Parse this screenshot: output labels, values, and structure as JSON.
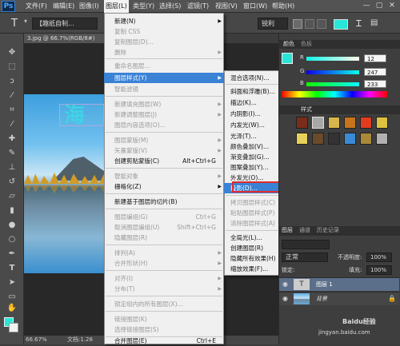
{
  "app": {
    "logo": "Ps"
  },
  "menubar": {
    "items": [
      "文件(F)",
      "编辑(E)",
      "图像(I)",
      "图层(L)",
      "类型(Y)",
      "选择(S)",
      "滤镜(T)",
      "视图(V)",
      "窗口(W)",
      "帮助(H)"
    ],
    "active_index": 3,
    "window_controls": [
      "—",
      "▢",
      "✕"
    ]
  },
  "options_bar": {
    "font_family": "【趣纸自制...",
    "font_style": "Regular",
    "font_size": "62.4 点",
    "antialias": "锐利",
    "color": "#27e6d8"
  },
  "document": {
    "tab_title": "3.jpg @ 66.7%(RGB/8#)",
    "zoom": "66.67%",
    "status_doc": "文档:1.28",
    "sign_text": "海"
  },
  "layer_menu": {
    "items": [
      {
        "label": "新建(N)",
        "arrow": true
      },
      {
        "label": "复制 CSS",
        "disabled": true
      },
      {
        "label": "复制图层(D)...",
        "disabled": true
      },
      {
        "label": "删除",
        "arrow": true,
        "disabled": true
      },
      {
        "label": "重命名图层...",
        "disabled": true
      },
      {
        "label": "图层样式(Y)",
        "arrow": true,
        "highlight": true
      },
      {
        "label": "智能滤镜",
        "disabled": true
      },
      {
        "label": "新建填充图层(W)",
        "arrow": true,
        "disabled": true
      },
      {
        "label": "新建调整图层(J)",
        "arrow": true,
        "disabled": true
      },
      {
        "label": "图层内容选项(O)...",
        "disabled": true
      },
      {
        "label": "图层蒙版(M)",
        "arrow": true,
        "disabled": true
      },
      {
        "label": "矢量蒙版(V)",
        "arrow": true,
        "disabled": true
      },
      {
        "label": "创建剪贴蒙版(C)",
        "shortcut": "Alt+Ctrl+G"
      },
      {
        "label": "智能对象",
        "arrow": true,
        "disabled": true
      },
      {
        "label": "栅格化(Z)",
        "arrow": true
      },
      {
        "label": "新建基于图层的切片(B)"
      },
      {
        "label": "图层编组(G)",
        "shortcut": "Ctrl+G",
        "disabled": true
      },
      {
        "label": "取消图层编组(U)",
        "shortcut": "Shift+Ctrl+G",
        "disabled": true
      },
      {
        "label": "隐藏图层(R)",
        "disabled": true
      },
      {
        "label": "排列(A)",
        "arrow": true,
        "disabled": true
      },
      {
        "label": "合并形状(H)",
        "arrow": true,
        "disabled": true
      },
      {
        "label": "对齐(I)",
        "arrow": true,
        "disabled": true
      },
      {
        "label": "分布(T)",
        "arrow": true,
        "disabled": true
      },
      {
        "label": "锁定组内的所有图层(X)...",
        "disabled": true
      },
      {
        "label": "链接图层(K)",
        "disabled": true
      },
      {
        "label": "选择链接图层(S)",
        "disabled": true
      },
      {
        "label": "合并图层(E)",
        "shortcut": "Ctrl+E"
      }
    ]
  },
  "style_submenu": {
    "items": [
      {
        "label": "混合选项(N)..."
      },
      {
        "label": "斜面和浮雕(B)..."
      },
      {
        "label": "描边(K)..."
      },
      {
        "label": "内阴影(I)..."
      },
      {
        "label": "内发光(W)..."
      },
      {
        "label": "光泽(T)..."
      },
      {
        "label": "颜色叠加(V)..."
      },
      {
        "label": "渐变叠加(G)..."
      },
      {
        "label": "图案叠加(Y)..."
      },
      {
        "label": "外发光(O)..."
      },
      {
        "label": "投影(D)...",
        "highlight": true
      },
      {
        "label": "拷贝图层样式(C)",
        "disabled": true
      },
      {
        "label": "粘贴图层样式(P)",
        "disabled": true
      },
      {
        "label": "清除图层样式(A)",
        "disabled": true
      },
      {
        "label": "全局光(L)..."
      },
      {
        "label": "创建图层(R)"
      },
      {
        "label": "隐藏所有效果(H)"
      },
      {
        "label": "缩放效果(F)..."
      }
    ]
  },
  "color_panel": {
    "tabs": [
      "颜色",
      "色板"
    ],
    "r": "12",
    "g": "247",
    "b": "233",
    "r_label": "R",
    "g_label": "G",
    "b_label": "B"
  },
  "styles_panel": {
    "tab": "样式"
  },
  "layers_panel": {
    "tabs": [
      "图层",
      "通道",
      "历史记录"
    ],
    "mode": "正常",
    "opacity_label": "不透明度:",
    "opacity": "100%",
    "lock_label": "锁定:",
    "fill_label": "填充:",
    "fill": "100%",
    "layers": [
      {
        "name": "图层 1"
      },
      {
        "name": "背景"
      }
    ]
  },
  "watermark": {
    "brand": "Baidu经验",
    "url": "jingyan.baidu.com"
  },
  "colors": {
    "accent": "#3a82d6",
    "highlight_border": "#e32a2a",
    "foreground": "#27e6d8"
  }
}
